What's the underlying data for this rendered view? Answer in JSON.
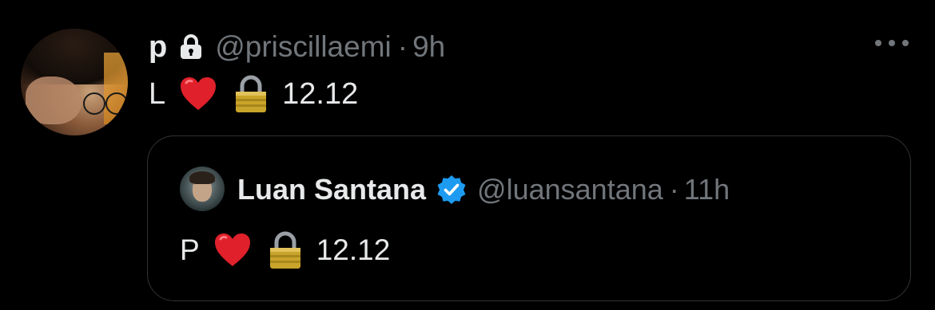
{
  "tweet": {
    "display_name": "p",
    "handle": "@priscillaemi",
    "separator": "·",
    "time": "9h",
    "text_letter": "L",
    "text_number": "12.12",
    "icons": [
      "lock-icon",
      "heart-emoji",
      "padlock-emoji",
      "more-icon"
    ]
  },
  "quote": {
    "display_name": "Luan Santana",
    "handle": "@luansantana",
    "separator": "·",
    "time": "11h",
    "text_letter": "P",
    "text_number": "12.12",
    "icons": [
      "verified-icon",
      "heart-emoji",
      "padlock-emoji"
    ]
  },
  "colors": {
    "background": "#000000",
    "primary_text": "#e7e9ea",
    "secondary_text": "#71767b",
    "border": "#2f3336",
    "verified": "#1d9bf0"
  }
}
